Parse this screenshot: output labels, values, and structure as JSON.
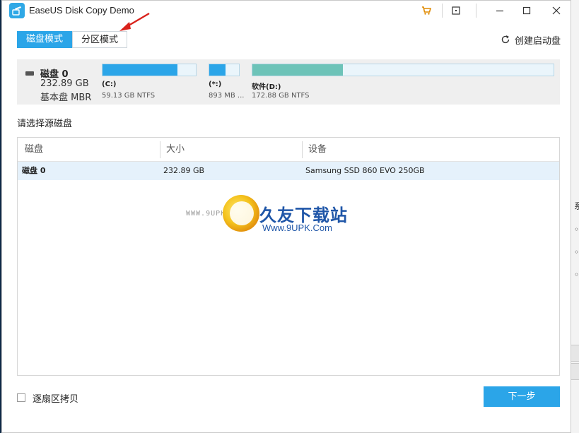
{
  "window": {
    "title": "EaseUS Disk Copy Demo"
  },
  "modes": {
    "disk_mode": "磁盘模式",
    "partition_mode": "分区模式"
  },
  "create_boot_disk": "创建启动盘",
  "disk": {
    "name": "磁盘 0",
    "size": "232.89 GB",
    "type": "基本盘 MBR",
    "partitions": [
      {
        "label": "(C:)",
        "info": "59.13 GB NTFS",
        "fill_fraction": 0.8,
        "color": "#2ba5e8"
      },
      {
        "label": "(*:)",
        "info": "893 MB ...",
        "fill_fraction": 0.55,
        "color": "#2ba5e8"
      },
      {
        "label": "软件(D:)",
        "info": "172.88 GB NTFS",
        "fill_fraction": 0.3,
        "color": "#6dc3b8"
      }
    ]
  },
  "select_source_title": "请选择源磁盘",
  "table": {
    "headers": [
      "磁盘",
      "大小",
      "设备"
    ],
    "rows": [
      {
        "disk": "磁盘 0",
        "size": "232.89 GB",
        "device": "Samsung SSD 860 EVO 250GB"
      }
    ]
  },
  "watermark": {
    "url_small": "WWW.9UPK.COM",
    "brand": "久友下载站",
    "url": "Www.9UPK.Com"
  },
  "sector_copy_label": "逐扇区拷贝",
  "next_button": "下一步",
  "background_fragments": [
    "系",
    "◦",
    "◦",
    "◦"
  ],
  "colors": {
    "accent": "#2ba5e8",
    "partition_d": "#6dc3b8",
    "arrow": "#d9221b"
  }
}
